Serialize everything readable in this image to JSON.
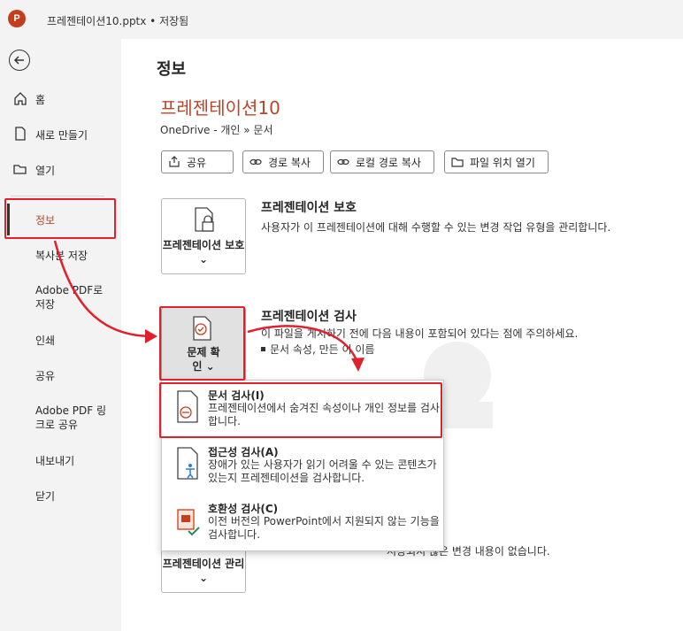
{
  "titlebar": {
    "app_letter": "P",
    "title": "프레젠테이션10.pptx • 저장됨"
  },
  "sidebar": {
    "items": [
      {
        "label": "홈"
      },
      {
        "label": "새로 만들기"
      },
      {
        "label": "열기"
      },
      {
        "label": "정보"
      },
      {
        "label": "복사본 저장"
      },
      {
        "label": "Adobe PDF로 저장"
      },
      {
        "label": "인쇄"
      },
      {
        "label": "공유"
      },
      {
        "label": "Adobe PDF 링크로 공유"
      },
      {
        "label": "내보내기"
      },
      {
        "label": "닫기"
      }
    ]
  },
  "main": {
    "heading": "정보",
    "doc_title": "프레젠테이션10",
    "breadcrumb": "OneDrive - 개인 » 문서",
    "buttons": [
      "공유",
      "경로 복사",
      "로컬 경로 복사",
      "파일 위치 열기"
    ],
    "protect": {
      "button_label": "프레젠테이션 보호 ⌄",
      "title": "프레젠테이션 보호",
      "desc": "사용자가 이 프레젠테이션에 대해 수행할 수 있는 변경 작업 유형을 관리합니다."
    },
    "inspect": {
      "button_label": "문제 확인 ⌄",
      "title": "프레젠테이션 검사",
      "desc": "이 파일을 게시하기 전에 다음 내용이 포함되어 있다는 점에 주의하세요.",
      "bullet": "문서 속성, 만든 이 이름"
    },
    "manage": {
      "button_label": "프레젠테이션 관리 ⌄",
      "desc_partial": "저장되지 않은 변경 내용이 없습니다."
    },
    "dropdown": [
      {
        "title": "문서 검사(I)",
        "desc": "프레젠테이션에서 숨겨진 속성이나 개인 정보를 검사합니다."
      },
      {
        "title": "접근성 검사(A)",
        "desc": "장애가 있는 사용자가 읽기 어려울 수 있는 콘텐츠가 있는지 프레젠테이션을 검사합니다."
      },
      {
        "title": "호환성 검사(C)",
        "desc": "이전 버전의 PowerPoint에서 지원되지 않는 기능을 검사합니다."
      }
    ]
  },
  "colors": {
    "accent": "#b7472a",
    "highlight": "#e0212b",
    "app_icon": "#c43e1c"
  }
}
